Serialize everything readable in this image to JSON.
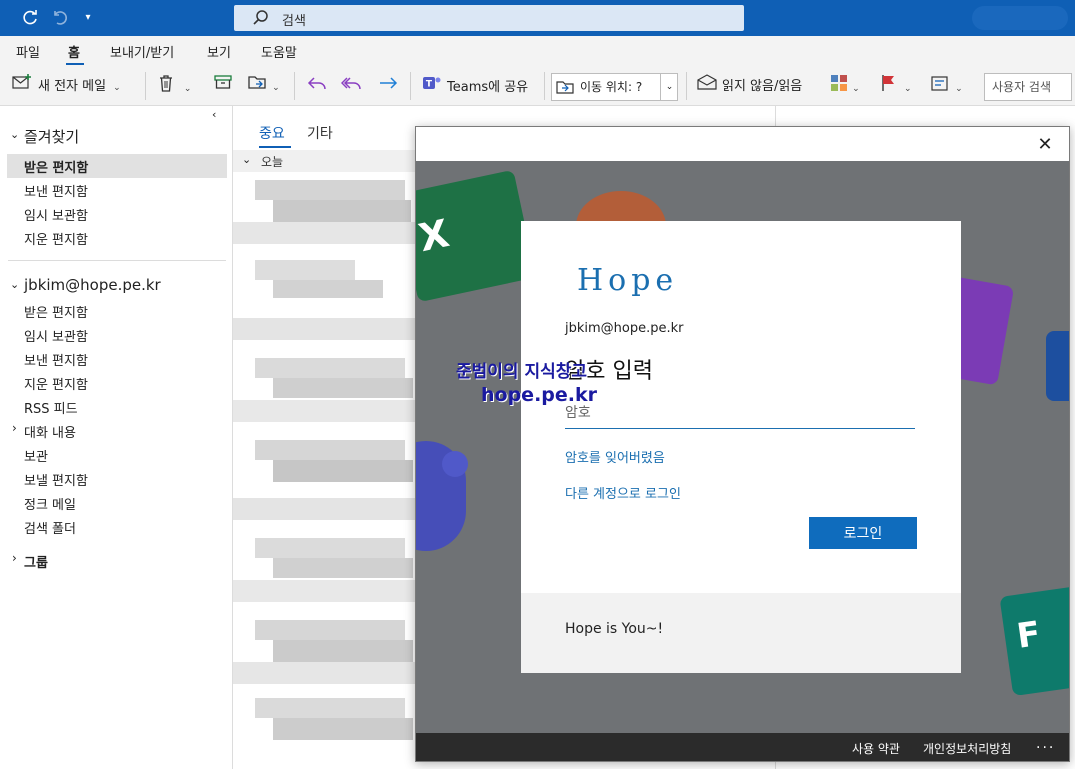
{
  "title_bar": {
    "search_placeholder": "검색",
    "icons": [
      "sync-icon",
      "undo-icon",
      "quick-access-dropdown-icon",
      "search-icon"
    ]
  },
  "menu": {
    "tabs": [
      "파일",
      "홈",
      "보내기/받기",
      "보기",
      "도움말"
    ],
    "active": "홈"
  },
  "ribbon": {
    "new_email": "새 전자 메일",
    "teams_share": "Teams에 공유",
    "move_to": "이동 위치: ?",
    "read_unread": "읽지 않음/읽음",
    "user_search_placeholder": "사용자 검색"
  },
  "folders": {
    "favorites_header": "즐겨찾기",
    "favorites": [
      "받은 편지함",
      "보낸 편지함",
      "임시 보관함",
      "지운 편지함"
    ],
    "account_header": "jbkim@hope.pe.kr",
    "account_items": [
      "받은 편지함",
      "임시 보관함",
      "보낸 편지함",
      "지운 편지함",
      "RSS 피드",
      "대화 내용",
      "보관",
      "보낼 편지함",
      "정크 메일",
      "검색 폴더"
    ],
    "groups_header": "그룹"
  },
  "message_list": {
    "tabs": [
      "중요",
      "기타"
    ],
    "active_tab": "중요",
    "group_label": "오늘"
  },
  "dialog": {
    "brand": "Hope",
    "email": "jbkim@hope.pe.kr",
    "title": "암호 입력",
    "password_placeholder": "암호",
    "forgot_password": "암호를 잊어버렸음",
    "other_account": "다른 계정으로 로그인",
    "login_button": "로그인",
    "tagline": "Hope is You~!",
    "footer_terms": "사용 약관",
    "footer_privacy": "개인정보처리방침",
    "footer_more": "..."
  },
  "watermark": {
    "line1": "준범이의 지식창고",
    "line2": "hope.pe.kr"
  },
  "colors": {
    "accent": "#0f5fb5",
    "login_button": "#0f6cbd",
    "brand_text": "#1b6fb0"
  }
}
